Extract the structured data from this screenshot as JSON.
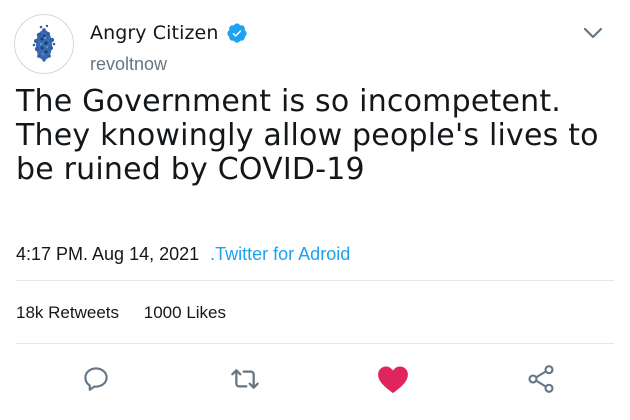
{
  "user": {
    "display_name": "Angry Citizen",
    "handle": "revoltnow",
    "verified": true
  },
  "tweet": {
    "text": "The Government is so incompetent. They knowingly allow people's lives to be ruined by COVID-19",
    "timestamp": "4:17 PM. Aug 14, 2021",
    "source": ".Twitter for Adroid"
  },
  "stats": {
    "retweets_count": "18k",
    "retweets_label": "Retweets",
    "likes_count": "1000",
    "likes_label": "Likes"
  },
  "actions": {
    "reply_icon": "speech-bubble-icon",
    "retweet_icon": "retweet-arrows-icon",
    "like_icon": "heart-icon",
    "share_icon": "share-icon"
  },
  "colors": {
    "accent": "#1da1f2",
    "like": "#e0245e",
    "secondary_text": "#657786",
    "icon": "#657786",
    "divider": "#e1e8ed"
  }
}
